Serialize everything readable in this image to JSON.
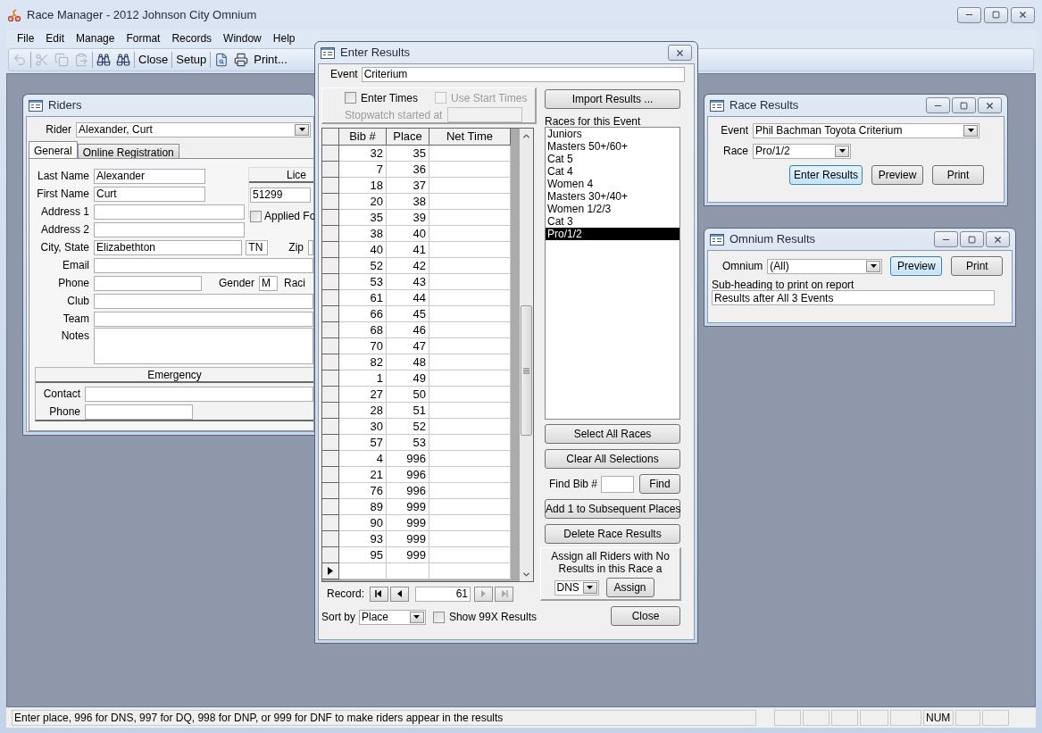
{
  "app": {
    "title": "Race Manager - 2012 Johnson City Omnium"
  },
  "menu": [
    "File",
    "Edit",
    "Manage",
    "Format",
    "Records",
    "Window",
    "Help"
  ],
  "toolbar": [
    [
      {
        "kind": "icon",
        "disabled": true
      }
    ],
    [
      {
        "kind": "icon",
        "disabled": true
      },
      {
        "kind": "icon",
        "disabled": true
      },
      {
        "kind": "icon",
        "disabled": true
      }
    ],
    [
      {
        "kind": "icon",
        "disabled": false
      },
      {
        "kind": "icon",
        "disabled": false
      }
    ],
    [
      {
        "kind": "text",
        "label": "Close"
      }
    ],
    [
      {
        "kind": "text",
        "label": "Setup"
      }
    ],
    [
      {
        "kind": "icon",
        "disabled": false
      },
      {
        "kind": "icon",
        "disabled": false
      },
      {
        "kind": "text",
        "label": "Print..."
      }
    ]
  ],
  "riders": {
    "title": "Riders",
    "rider_label": "Rider",
    "rider_value": "Alexander, Curt",
    "tabs": [
      {
        "label": "General",
        "selected": true
      },
      {
        "label": "Online Registration",
        "selected": false
      }
    ],
    "last_name": {
      "label": "Last Name",
      "value": "Alexander"
    },
    "first_name": {
      "label": "First Name",
      "value": "Curt"
    },
    "address_1": {
      "label": "Address 1"
    },
    "address_2": {
      "label": "Address 2"
    },
    "city_state": {
      "label": "City, State",
      "value": "Elizabethton",
      "state": "TN"
    },
    "zip_label": "Zip",
    "email": {
      "label": "Email"
    },
    "phone": {
      "label": "Phone"
    },
    "gender": {
      "label": "Gender",
      "value": "M"
    },
    "racing_label": "Raci",
    "club": {
      "label": "Club"
    },
    "team": {
      "label": "Team"
    },
    "notes": {
      "label": "Notes"
    },
    "license": {
      "header": "Lice",
      "value": "51299",
      "applied": {
        "label": "Applied Fo",
        "checked": false
      }
    },
    "emergency": {
      "header": "Emergency",
      "contact_label": "Contact",
      "phone_label": "Phone"
    }
  },
  "enter_results": {
    "title": "Enter Results",
    "event_label": "Event",
    "event_value": "Criterium",
    "enter_times": {
      "label": "Enter Times",
      "checked": false,
      "disabled": false
    },
    "use_start_times": {
      "label": "Use Start Times",
      "checked": false,
      "disabled": true
    },
    "stopwatch_label": "Stopwatch started at",
    "columns": [
      "Bib #",
      "Place",
      "Net Time"
    ],
    "rows": [
      {
        "bib": "32",
        "place": "35",
        "current": false
      },
      {
        "bib": "7",
        "place": "36",
        "current": false
      },
      {
        "bib": "18",
        "place": "37",
        "current": false
      },
      {
        "bib": "20",
        "place": "38",
        "current": false
      },
      {
        "bib": "35",
        "place": "39",
        "current": false
      },
      {
        "bib": "38",
        "place": "40",
        "current": false
      },
      {
        "bib": "40",
        "place": "41",
        "current": false
      },
      {
        "bib": "52",
        "place": "42",
        "current": false
      },
      {
        "bib": "53",
        "place": "43",
        "current": false
      },
      {
        "bib": "61",
        "place": "44",
        "current": false
      },
      {
        "bib": "66",
        "place": "45",
        "current": false
      },
      {
        "bib": "68",
        "place": "46",
        "current": false
      },
      {
        "bib": "70",
        "place": "47",
        "current": false
      },
      {
        "bib": "82",
        "place": "48",
        "current": false
      },
      {
        "bib": "1",
        "place": "49",
        "current": false
      },
      {
        "bib": "27",
        "place": "50",
        "current": false
      },
      {
        "bib": "28",
        "place": "51",
        "current": false
      },
      {
        "bib": "30",
        "place": "52",
        "current": false
      },
      {
        "bib": "57",
        "place": "53",
        "current": false
      },
      {
        "bib": "4",
        "place": "996",
        "current": false
      },
      {
        "bib": "21",
        "place": "996",
        "current": false
      },
      {
        "bib": "76",
        "place": "996",
        "current": false
      },
      {
        "bib": "89",
        "place": "999",
        "current": false
      },
      {
        "bib": "90",
        "place": "999",
        "current": false
      },
      {
        "bib": "93",
        "place": "999",
        "current": false
      },
      {
        "bib": "95",
        "place": "999",
        "current": false
      },
      {
        "current": true
      }
    ],
    "record_label": "Record:",
    "record_value": "61",
    "nav": [
      {
        "disabled": false
      },
      {
        "disabled": false
      },
      {
        "disabled": true
      },
      {
        "disabled": true
      }
    ],
    "sort_label": "Sort by",
    "sort_value": "Place",
    "show_99x": {
      "label": "Show 99X Results",
      "checked": false,
      "disabled": false
    },
    "import_button": "Import Results ...",
    "races_label": "Races for this Event",
    "races": [
      {
        "label": "Juniors",
        "selected": false
      },
      {
        "label": "Masters 50+/60+",
        "selected": false
      },
      {
        "label": "Cat 5",
        "selected": false
      },
      {
        "label": "Cat 4",
        "selected": false
      },
      {
        "label": "Women 4",
        "selected": false
      },
      {
        "label": "Masters 30+/40+",
        "selected": false
      },
      {
        "label": "Women 1/2/3",
        "selected": false
      },
      {
        "label": "Cat 3",
        "selected": false
      },
      {
        "label": "Pro/1/2",
        "selected": true
      }
    ],
    "select_all_button": "Select All Races",
    "clear_button": "Clear All Selections",
    "find_label": "Find Bib #",
    "find_button": "Find",
    "add_button": "Add 1 to Subsequent Places",
    "delete_button": "Delete Race Results",
    "assign_text": "Assign all Riders with No Results in this Race a",
    "assign_value": "DNS",
    "assign_button": "Assign",
    "close_button": "Close"
  },
  "race_results": {
    "title": "Race Results",
    "event_label": "Event",
    "event_value": "Phil Bachman Toyota Criterium",
    "race_label": "Race",
    "race_value": "Pro/1/2",
    "buttons": [
      {
        "label": "Enter Results",
        "focused": true
      },
      {
        "label": "Preview",
        "focused": false
      },
      {
        "label": "Print",
        "focused": false
      }
    ]
  },
  "omnium_results": {
    "title": "Omnium Results",
    "omnium_label": "Omnium",
    "omnium_value": "(All)",
    "buttons": [
      {
        "label": "Preview",
        "focused": true
      },
      {
        "label": "Print",
        "focused": false
      }
    ],
    "subheading_label": "Sub-heading to print on report",
    "subheading_value": "Results after All 3 Events"
  },
  "status_bar": {
    "message": "Enter place, 996 for DNS, 997 for DQ, 998 for DNP, or 999 for DNF to make riders appear in the results",
    "indicators": [
      "NUM"
    ]
  }
}
